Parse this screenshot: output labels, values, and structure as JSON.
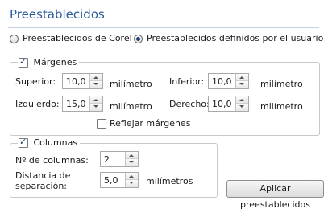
{
  "title": "Preestablecidos",
  "presets": {
    "option_corel": "Preestablecidos de Corel",
    "option_user": "Preestablecidos definidos por el usuario",
    "selected": "user"
  },
  "margins": {
    "label": "Márgenes",
    "checked": true,
    "top_label": "Superior:",
    "top_value": "10,0",
    "top_unit": "milímetro",
    "bottom_label": "Inferior:",
    "bottom_value": "10,0",
    "bottom_unit": "milímetro",
    "left_label": "Izquierdo:",
    "left_value": "15,0",
    "left_unit": "milímetro",
    "right_label": "Derecho:",
    "right_value": "10,0",
    "right_unit": "milímetro",
    "mirror_label": "Reflejar márgenes",
    "mirror_checked": false
  },
  "columns": {
    "label": "Columnas",
    "checked": true,
    "count_label": "Nº de columnas:",
    "count_value": "2",
    "spacing_label_line1": "Distancia de",
    "spacing_label_line2": "separación:",
    "spacing_value": "5,0",
    "spacing_unit": "milímetros"
  },
  "apply_button": "Aplicar preestablecidos"
}
